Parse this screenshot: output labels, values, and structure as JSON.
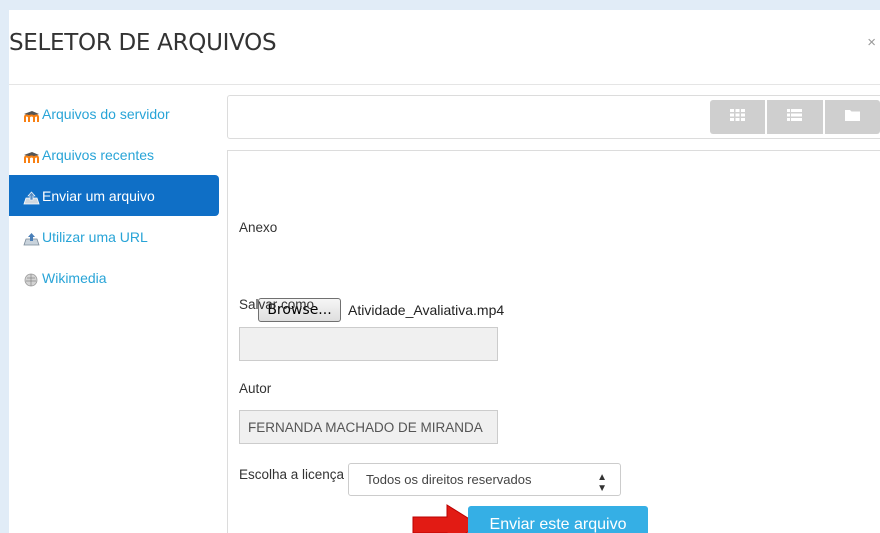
{
  "dialog": {
    "title": "SELETOR DE ARQUIVOS",
    "close_label": "×"
  },
  "sidebar": {
    "items": [
      {
        "label": "Arquivos do servidor",
        "icon": "moodle-icon"
      },
      {
        "label": "Arquivos recentes",
        "icon": "moodle-icon"
      },
      {
        "label": "Enviar um arquivo",
        "icon": "upload-icon",
        "active": true
      },
      {
        "label": "Utilizar uma URL",
        "icon": "url-icon"
      },
      {
        "label": "Wikimedia",
        "icon": "wikimedia-icon"
      }
    ]
  },
  "toolbar": {
    "view_buttons": [
      "grid-icon",
      "list-icon",
      "folder-icon"
    ]
  },
  "form": {
    "attachment_label": "Anexo",
    "browse_label": "Browse...",
    "file_name": "Atividade_Avaliativa.mp4",
    "save_as_label": "Salvar como",
    "save_as_value": "",
    "author_label": "Autor",
    "author_value": "FERNANDA MACHADO DE MIRANDA",
    "license_label": "Escolha a licença",
    "license_value": "Todos os direitos reservados",
    "submit_label": "Enviar este arquivo"
  },
  "colors": {
    "active_bg": "#0f6fc6",
    "link": "#28a4d7",
    "submit_bg": "#35afe5",
    "arrow": "#e21b14"
  }
}
